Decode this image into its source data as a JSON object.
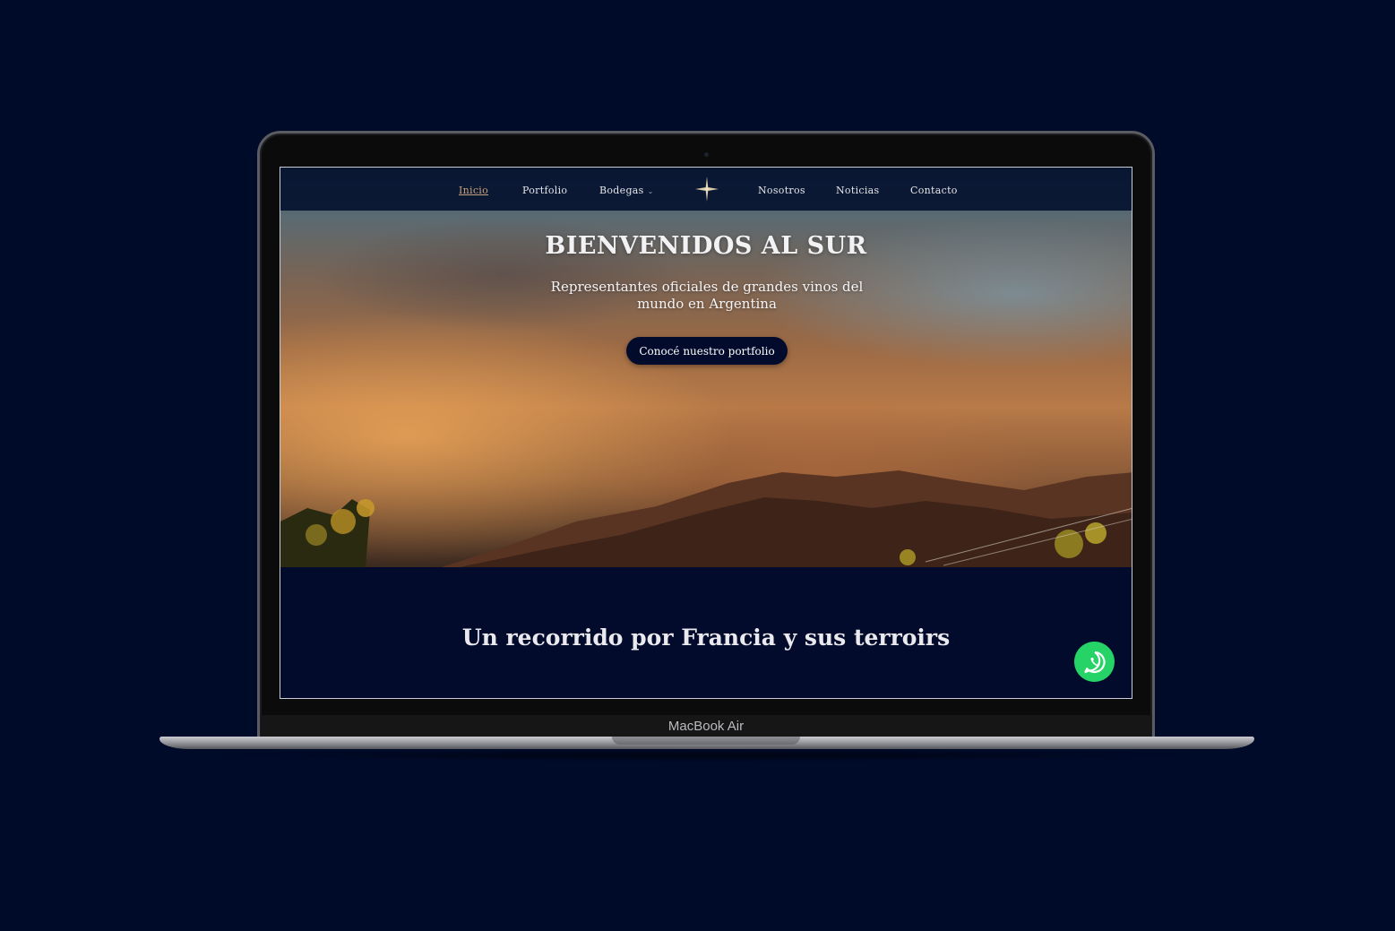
{
  "device": {
    "label": "MacBook Air"
  },
  "nav": {
    "items": [
      {
        "label": "Inicio",
        "active": true
      },
      {
        "label": "Portfolio",
        "active": false
      },
      {
        "label": "Bodegas",
        "active": false,
        "has_dropdown": true
      },
      {
        "label": "Nosotros",
        "active": false
      },
      {
        "label": "Noticias",
        "active": false
      },
      {
        "label": "Contacto",
        "active": false
      }
    ],
    "logo_icon": "compass-star-icon",
    "active_color": "#c9a27a"
  },
  "hero": {
    "title": "BIENVENIDOS AL SUR",
    "subtitle": "Representantes oficiales de grandes vinos del mundo en Argentina",
    "cta_label": "Conocé nuestro portfolio"
  },
  "section": {
    "title": "Un recorrido por Francia y sus terroirs"
  },
  "floating": {
    "whatsapp_icon": "whatsapp-icon",
    "color": "#25d366"
  },
  "colors": {
    "background": "#000a29",
    "site_navy": "#020b2c"
  }
}
